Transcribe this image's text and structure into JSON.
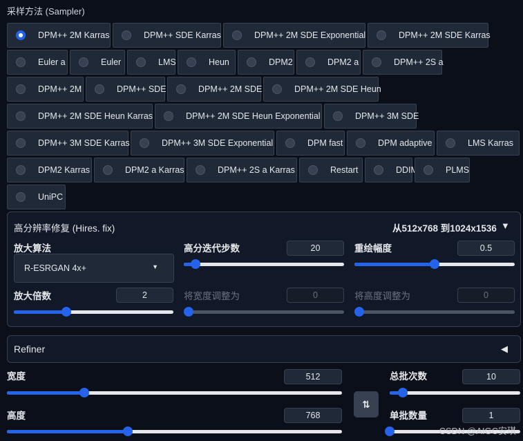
{
  "sampler": {
    "title": "采样方法 (Sampler)",
    "selected": "DPM++ 2M Karras",
    "rows": [
      [
        "DPM++ 2M Karras",
        "DPM++ SDE Karras",
        "DPM++ 2M SDE Exponential",
        "DPM++ 2M SDE Karras"
      ],
      [
        "Euler a",
        "Euler",
        "LMS",
        "Heun",
        "DPM2",
        "DPM2 a",
        "DPM++ 2S a"
      ],
      [
        "DPM++ 2M",
        "DPM++ SDE",
        "DPM++ 2M SDE",
        "DPM++ 2M SDE Heun"
      ],
      [
        "DPM++ 2M SDE Heun Karras",
        "DPM++ 2M SDE Heun Exponential",
        "DPM++ 3M SDE"
      ],
      [
        "DPM++ 3M SDE Karras",
        "DPM++ 3M SDE Exponential",
        "DPM fast",
        "DPM adaptive",
        "LMS Karras"
      ],
      [
        "DPM2 Karras",
        "DPM2 a Karras",
        "DPM++ 2S a Karras",
        "Restart",
        "DDIM",
        "PLMS"
      ],
      [
        "UniPC"
      ]
    ]
  },
  "hires": {
    "title": "高分辨率修复 (Hires. fix)",
    "summary": "从512x768 到1024x1536",
    "upscaler_label": "放大算法",
    "upscaler_value": "R-ESRGAN 4x+",
    "steps_label": "高分迭代步数",
    "steps_value": "20",
    "steps_fraction": 0.075,
    "denoise_label": "重绘幅度",
    "denoise_value": "0.5",
    "denoise_fraction": 0.5,
    "scale_label": "放大倍数",
    "scale_value": "2",
    "scale_fraction": 0.33,
    "resize_w_label": "将宽度调整为",
    "resize_w_value": "0",
    "resize_w_fraction": 0,
    "resize_h_label": "将高度调整为",
    "resize_h_value": "0",
    "resize_h_fraction": 0
  },
  "refiner": {
    "title": "Refiner"
  },
  "size": {
    "width_label": "宽度",
    "width_value": "512",
    "width_fraction": 0.231,
    "height_label": "高度",
    "height_value": "768",
    "height_fraction": 0.36,
    "batch_count_label": "总批次数",
    "batch_count_value": "10",
    "batch_count_fraction": 0.1,
    "batch_size_label": "单批数量",
    "batch_size_value": "1",
    "batch_size_fraction": 0
  },
  "icons": {
    "collapse": "▼",
    "expand": "◀",
    "dropdown": "▼",
    "swap": "⇅"
  },
  "watermark": "CSDN @AIGC安琪",
  "colors": {
    "accent": "#2563eb",
    "background": "#0b0f19",
    "panel": "#1f2937"
  }
}
